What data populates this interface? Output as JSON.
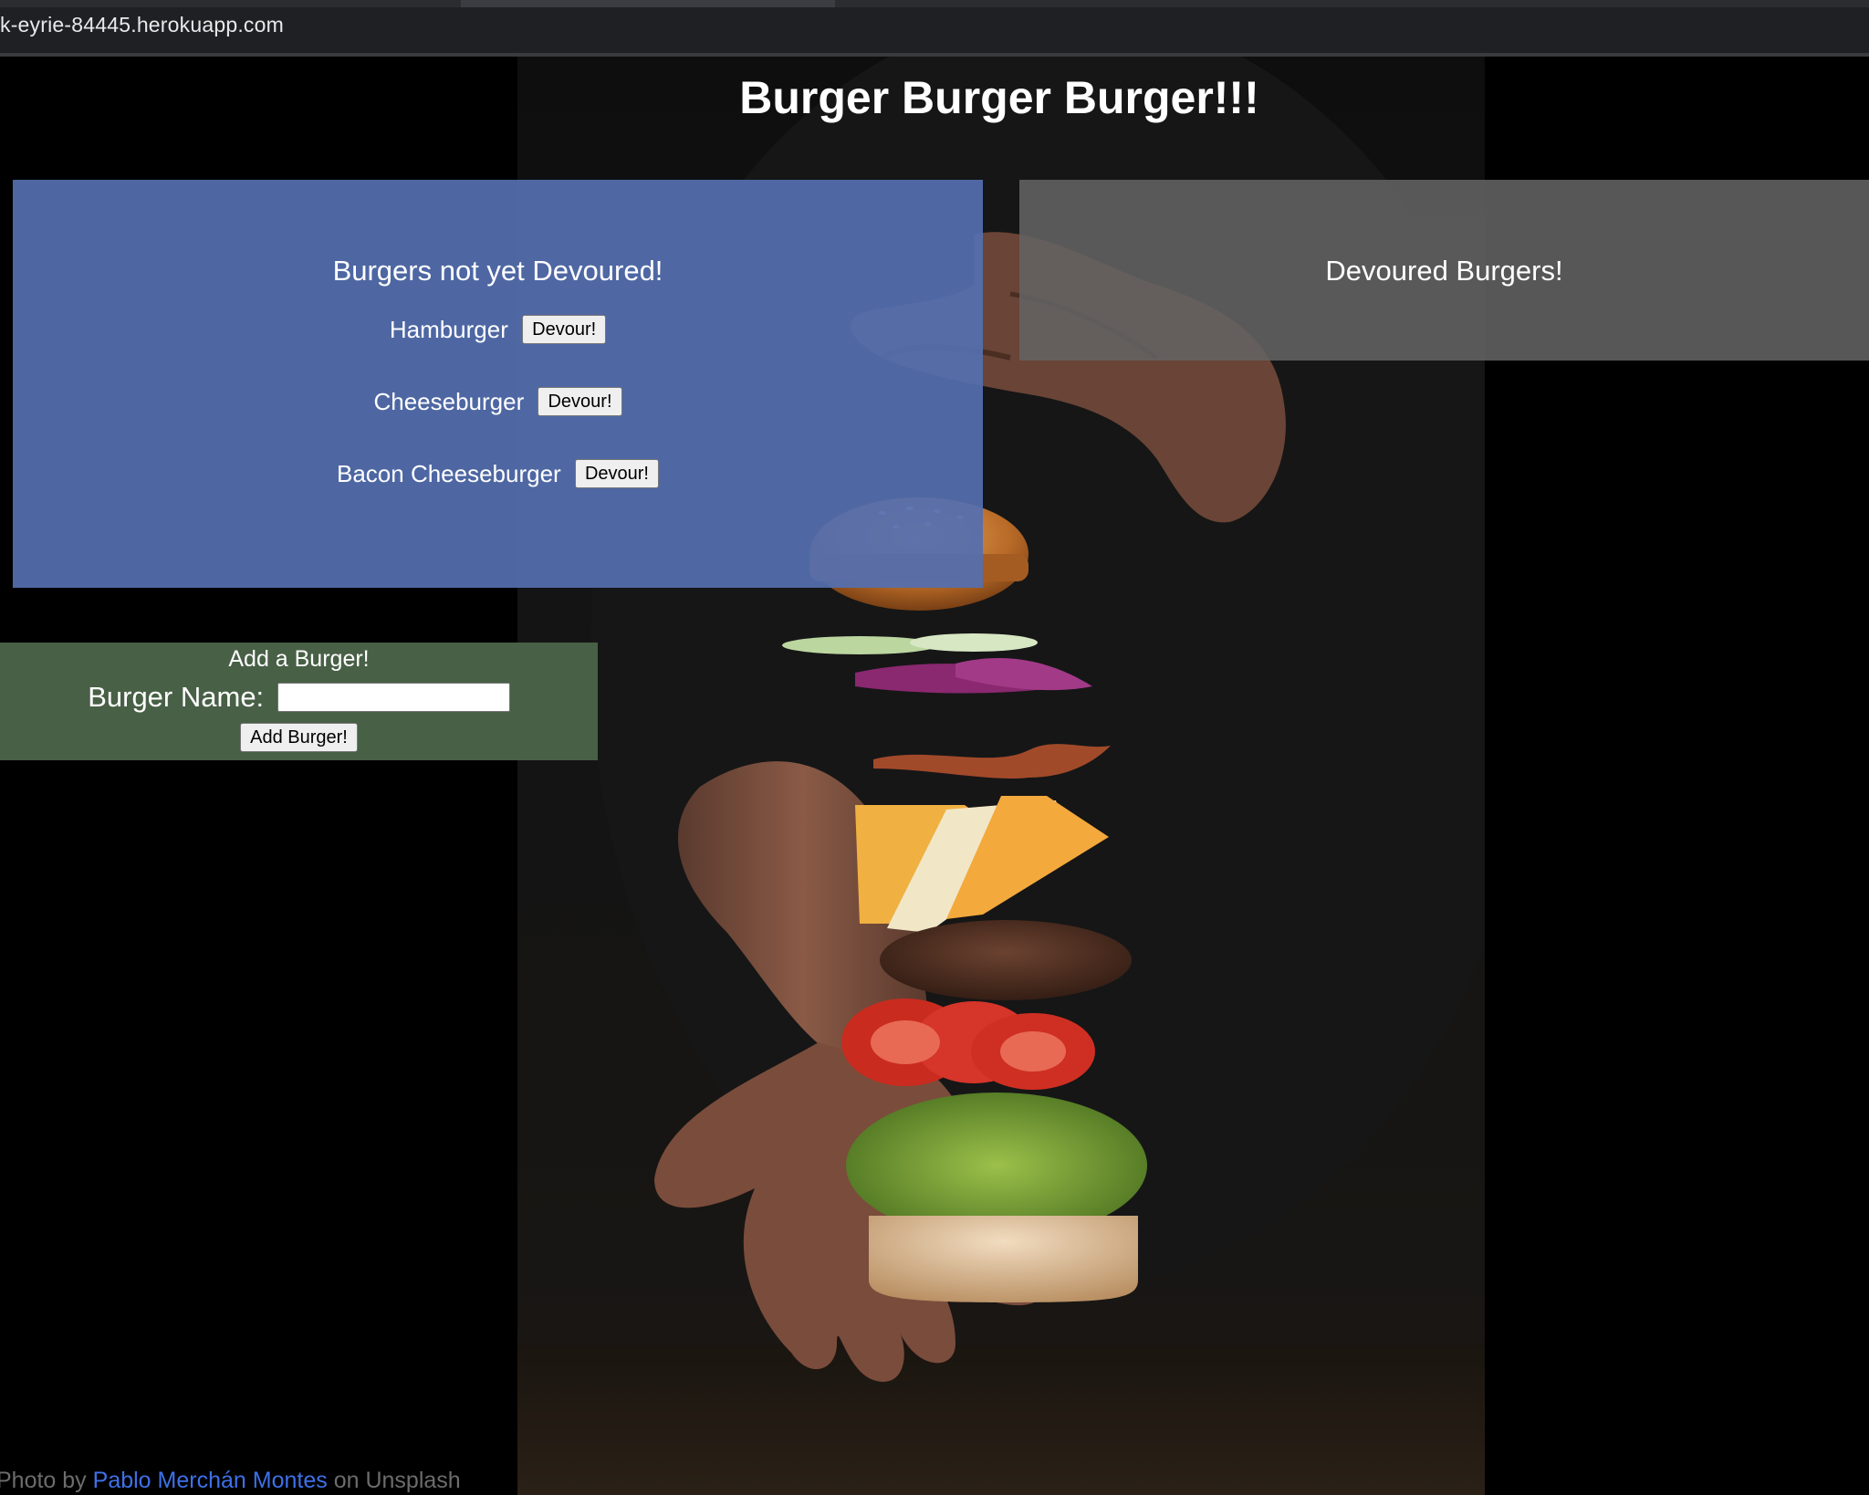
{
  "browser": {
    "url": "k-eyrie-84445.herokuapp.com"
  },
  "page": {
    "title": "Burger Burger Burger!!!"
  },
  "not_devoured": {
    "heading": "Burgers not yet Devoured!",
    "button_label": "Devour!",
    "items": [
      {
        "name": "Hamburger"
      },
      {
        "name": "Cheeseburger"
      },
      {
        "name": "Bacon Cheeseburger"
      }
    ]
  },
  "devoured": {
    "heading": "Devoured Burgers!",
    "items": []
  },
  "add_form": {
    "heading": "Add a Burger!",
    "name_label": "Burger Name:",
    "name_value": "",
    "submit_label": "Add Burger!"
  },
  "credit": {
    "prefix": "Photo by",
    "author": "Pablo Merchán Montes",
    "middle": "on",
    "site": "Unsplash"
  },
  "colors": {
    "not_devoured_panel": "#546faf",
    "devoured_panel": "#636363",
    "add_panel": "#4a6348",
    "link": "#3e70e8"
  }
}
